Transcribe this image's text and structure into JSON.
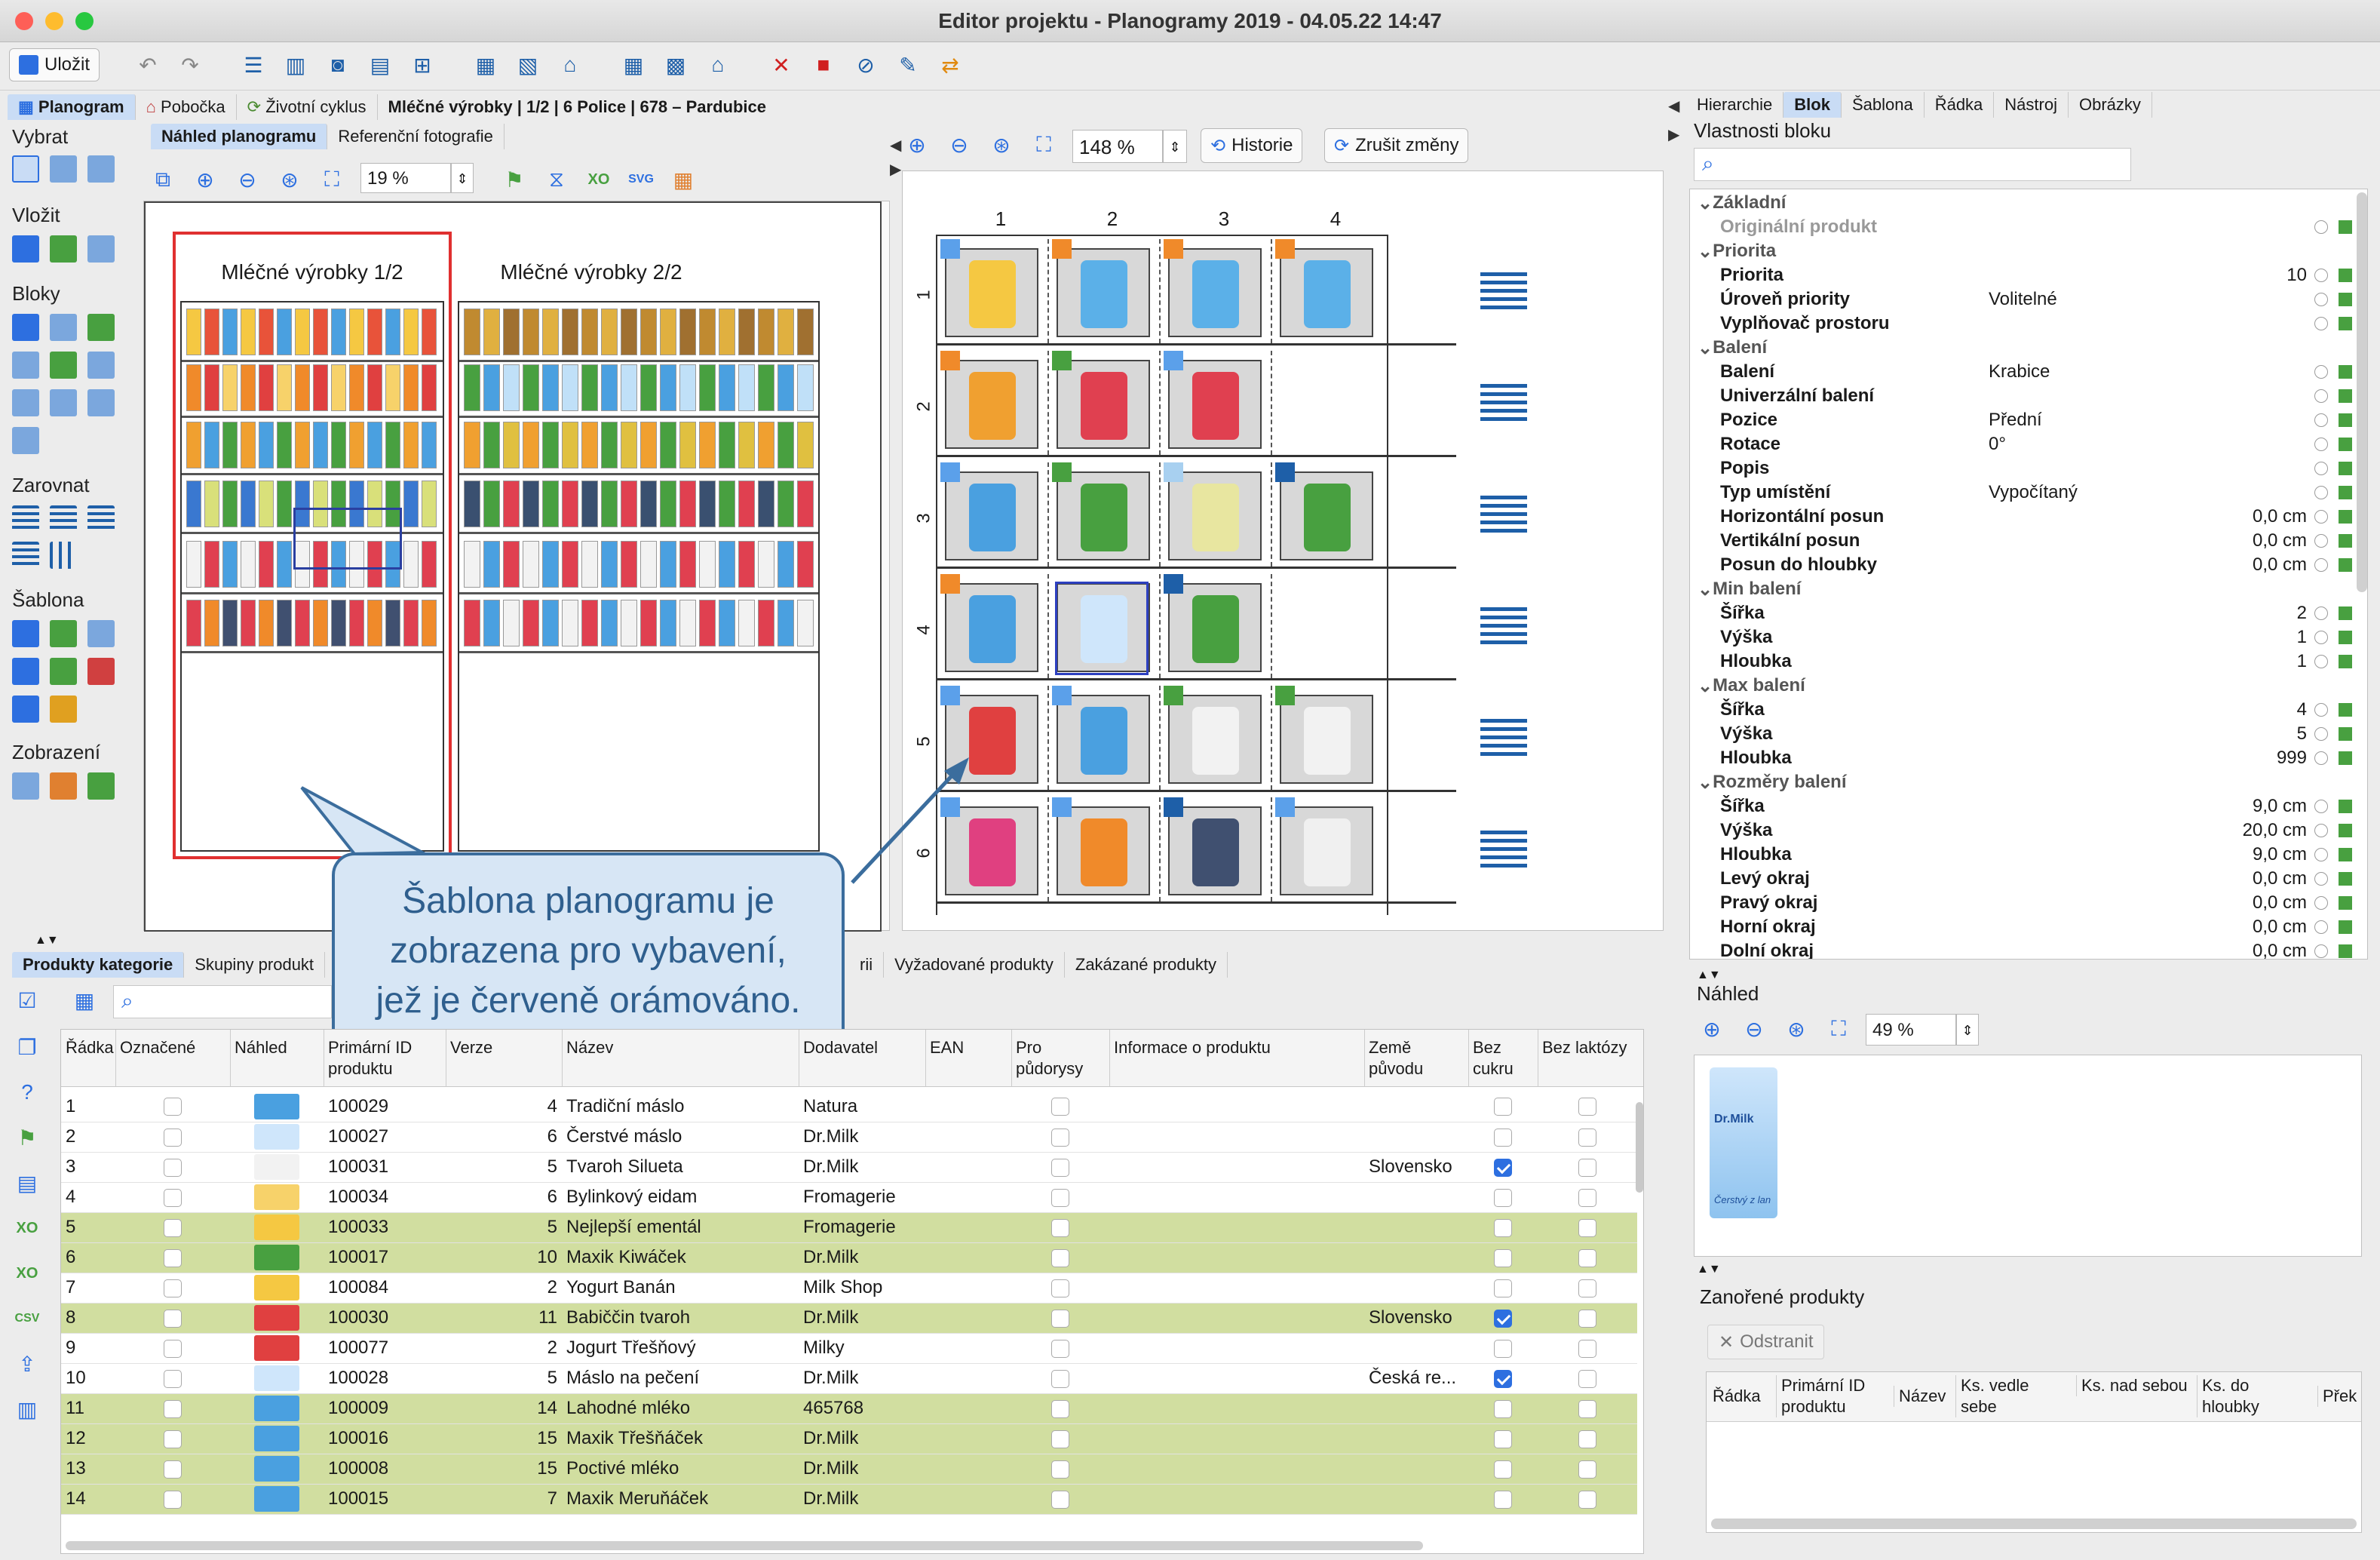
{
  "window": {
    "title": "Editor projektu - Planogramy 2019 - 04.05.22 14:47"
  },
  "toolbar": {
    "save_label": "Uložit",
    "history_label": "Historie",
    "discard_label": "Zrušit změny",
    "zoom_main": "148 %",
    "zoom_left": "19 %",
    "zoom_preview": "49 %"
  },
  "nav": {
    "tabs": [
      "Planogram",
      "Pobočka",
      "Životní cyklus"
    ],
    "breadcrumb": "Mléčné výrobky | 1/2 | 6 Police | 678 – Pardubice"
  },
  "left_sections": [
    "Vybrat",
    "Vložit",
    "Bloky",
    "Zarovnat",
    "Šablona",
    "Zobrazení"
  ],
  "preview_tabs": [
    "Náhled planogramu",
    "Referenční fotografie"
  ],
  "planogram": {
    "left_title": "Mléčné výrobky 1/2",
    "right_title": "Mléčné výrobky 2/2",
    "col_labels": [
      "1",
      "2",
      "3",
      "4"
    ],
    "row_labels": [
      "1",
      "2",
      "3",
      "4",
      "5",
      "6"
    ]
  },
  "callout": {
    "line1": "Šablona planogramu je",
    "line2": "zobrazena pro vybavení,",
    "line3": "jež je červeně orámováno."
  },
  "right_tabs": [
    "Hierarchie",
    "Blok",
    "Šablona",
    "Řádka",
    "Nástroj",
    "Obrázky"
  ],
  "props": {
    "title": "Vlastnosti bloku",
    "rows": [
      {
        "k": "Základní",
        "sec": true
      },
      {
        "k": "Originální produkt",
        "dim": true
      },
      {
        "k": "Priorita",
        "sec": true
      },
      {
        "k": "Priorita",
        "num": "10"
      },
      {
        "k": "Úroveň priority",
        "v": "Volitelné"
      },
      {
        "k": "Vyplňovač prostoru"
      },
      {
        "k": "Balení",
        "sec": true
      },
      {
        "k": "Balení",
        "v": "Krabice"
      },
      {
        "k": "Univerzální balení"
      },
      {
        "k": "Pozice",
        "v": "Přední"
      },
      {
        "k": "Rotace",
        "v": "0°"
      },
      {
        "k": "Popis"
      },
      {
        "k": "Typ umístění",
        "v": "Vypočítaný"
      },
      {
        "k": "Horizontální posun",
        "num": "0,0 cm"
      },
      {
        "k": "Vertikální posun",
        "num": "0,0 cm"
      },
      {
        "k": "Posun do hloubky",
        "num": "0,0 cm"
      },
      {
        "k": "Min balení",
        "sec": true
      },
      {
        "k": "Šířka",
        "num": "2"
      },
      {
        "k": "Výška",
        "num": "1"
      },
      {
        "k": "Hloubka",
        "num": "1"
      },
      {
        "k": "Max balení",
        "sec": true
      },
      {
        "k": "Šířka",
        "num": "4"
      },
      {
        "k": "Výška",
        "num": "5"
      },
      {
        "k": "Hloubka",
        "num": "999"
      },
      {
        "k": "Rozměry balení",
        "sec": true
      },
      {
        "k": "Šířka",
        "num": "9,0 cm"
      },
      {
        "k": "Výška",
        "num": "20,0 cm"
      },
      {
        "k": "Hloubka",
        "num": "9,0 cm"
      },
      {
        "k": "Levý okraj",
        "num": "0,0 cm"
      },
      {
        "k": "Pravý okraj",
        "num": "0,0 cm"
      },
      {
        "k": "Horní okraj",
        "num": "0,0 cm"
      },
      {
        "k": "Dolní okraj",
        "num": "0,0 cm"
      }
    ]
  },
  "preview": {
    "title": "Náhled",
    "product_brand": "Dr.Milk",
    "product_caption": "Čerstvý z lan"
  },
  "nested": {
    "title": "Zanořené produkty",
    "remove_label": "Odstranit",
    "columns": [
      "Řádka",
      "Primární ID produktu",
      "Název",
      "Ks. vedle sebe",
      "Ks. nad sebou",
      "Ks. do hloubky",
      "Přek"
    ]
  },
  "bottom_tabs": [
    "Produkty kategorie",
    "Skupiny produkt",
    "rii",
    "Vyžadované produkty",
    "Zakázané produkty"
  ],
  "table": {
    "columns": [
      "Řádka",
      "Označené",
      "Náhled",
      "Primární ID produktu",
      "Verze",
      "Název",
      "Dodavatel",
      "EAN",
      "Pro půdorysy",
      "Informace o produktu",
      "Země původu",
      "Bez cukru",
      "Bez laktózy"
    ],
    "rows": [
      {
        "n": "1",
        "id": "100029",
        "ver": "4",
        "name": "Tradiční máslo",
        "sup": "Natura",
        "country": "",
        "sugar": false,
        "hl": false
      },
      {
        "n": "2",
        "id": "100027",
        "ver": "6",
        "name": "Čerstvé máslo",
        "sup": "Dr.Milk",
        "country": "",
        "sugar": false,
        "hl": false
      },
      {
        "n": "3",
        "id": "100031",
        "ver": "5",
        "name": "Tvaroh Silueta",
        "sup": "Dr.Milk",
        "country": "Slovensko",
        "sugar": true,
        "hl": false
      },
      {
        "n": "4",
        "id": "100034",
        "ver": "6",
        "name": "Bylinkový eidam",
        "sup": "Fromagerie",
        "country": "",
        "sugar": false,
        "hl": false
      },
      {
        "n": "5",
        "id": "100033",
        "ver": "5",
        "name": "Nejlepší ementál",
        "sup": "Fromagerie",
        "country": "",
        "sugar": false,
        "hl": true
      },
      {
        "n": "6",
        "id": "100017",
        "ver": "10",
        "name": "Maxik Kiwáček",
        "sup": "Dr.Milk",
        "country": "",
        "sugar": false,
        "hl": true
      },
      {
        "n": "7",
        "id": "100084",
        "ver": "2",
        "name": "Yogurt Banán",
        "sup": "Milk Shop",
        "country": "",
        "sugar": false,
        "hl": false
      },
      {
        "n": "8",
        "id": "100030",
        "ver": "11",
        "name": "Babiččin tvaroh",
        "sup": "Dr.Milk",
        "country": "Slovensko",
        "sugar": true,
        "hl": true
      },
      {
        "n": "9",
        "id": "100077",
        "ver": "2",
        "name": "Jogurt Třešňový",
        "sup": "Milky",
        "country": "",
        "sugar": false,
        "hl": false
      },
      {
        "n": "10",
        "id": "100028",
        "ver": "5",
        "name": "Máslo na pečení",
        "sup": "Dr.Milk",
        "country": "Česká re...",
        "sugar": true,
        "hl": false
      },
      {
        "n": "11",
        "id": "100009",
        "ver": "14",
        "name": "Lahodné mléko",
        "sup": "465768",
        "country": "",
        "sugar": false,
        "hl": true
      },
      {
        "n": "12",
        "id": "100016",
        "ver": "15",
        "name": "Maxik Třešňáček",
        "sup": "Dr.Milk",
        "country": "",
        "sugar": false,
        "hl": true
      },
      {
        "n": "13",
        "id": "100008",
        "ver": "15",
        "name": "Poctivé mléko",
        "sup": "Dr.Milk",
        "country": "",
        "sugar": false,
        "hl": true
      },
      {
        "n": "14",
        "id": "100015",
        "ver": "7",
        "name": "Maxik Meruňáček",
        "sup": "Dr.Milk",
        "country": "",
        "sugar": false,
        "hl": true
      }
    ]
  },
  "colors": {
    "accent": "#2d6fe0",
    "highlight_row": "#d1dea0",
    "selection_red": "#e03030",
    "callout_border": "#3b6d9d"
  }
}
